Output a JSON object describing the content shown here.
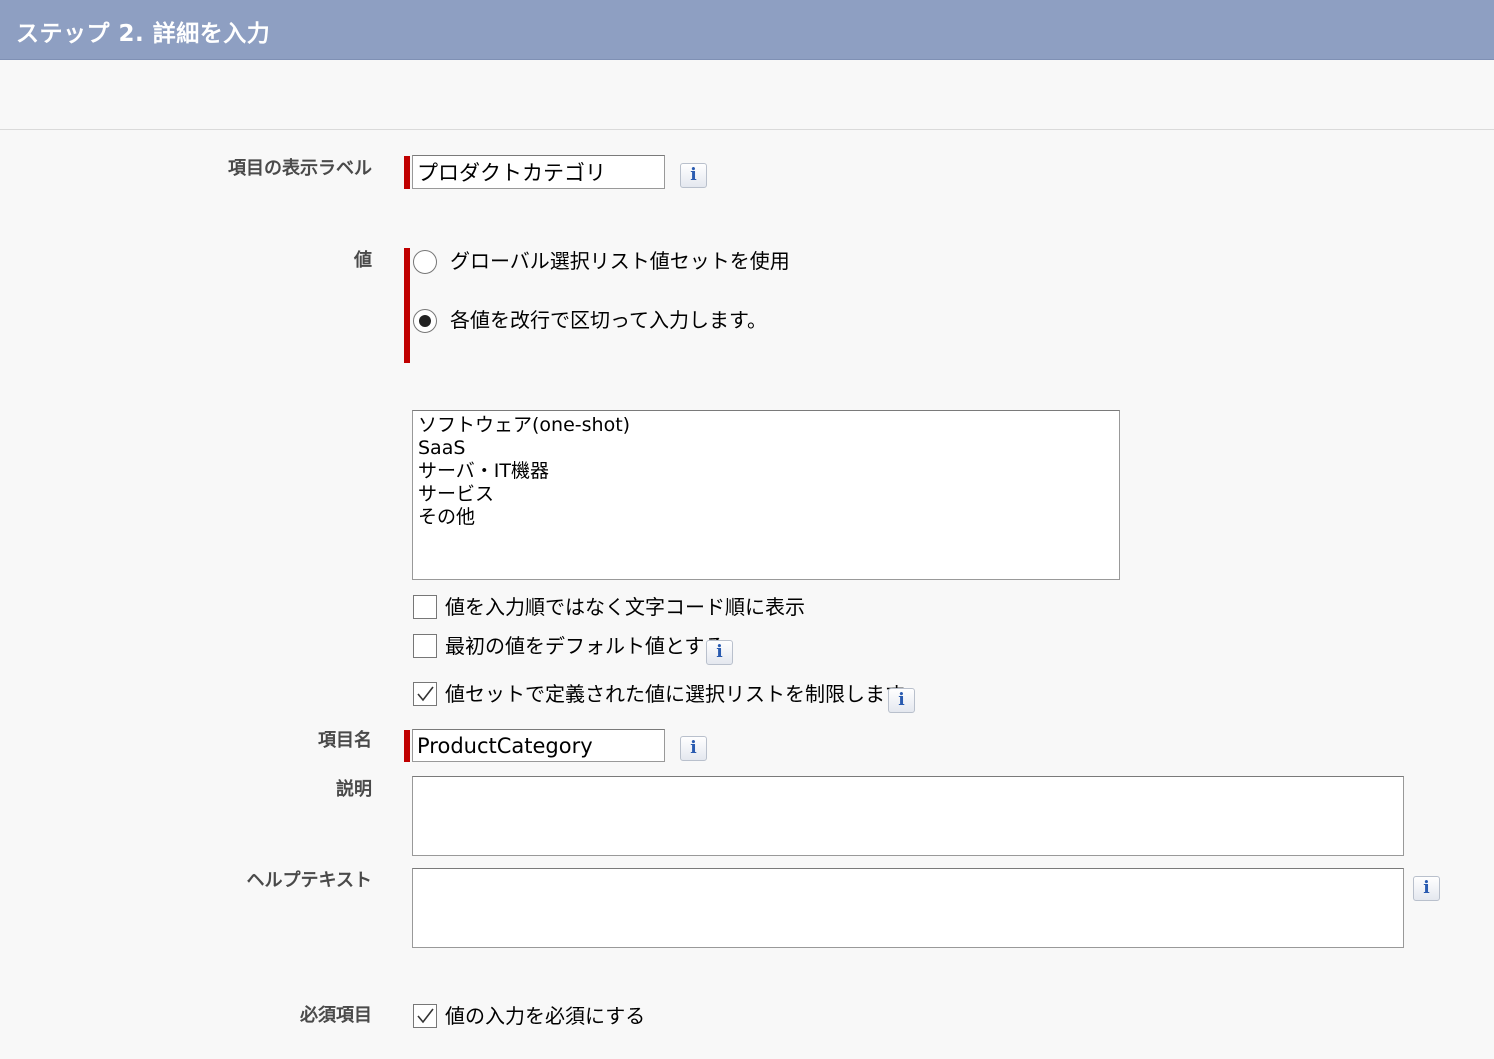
{
  "header": {
    "title": "ステップ 2. 詳細を入力"
  },
  "form": {
    "field_label": {
      "label": "項目の表示ラベル",
      "value": "プロダクトカテゴリ",
      "info_glyph": "i"
    },
    "values": {
      "label": "値",
      "options": [
        {
          "label": "グローバル選択リスト値セットを使用",
          "selected": false
        },
        {
          "label": "各値を改行で区切って入力します。",
          "selected": true
        }
      ],
      "entries": "ソフトウェア(one-shot)\nSaaS\nサーバ・IT機器\nサービス\nその他",
      "checkboxes": [
        {
          "label": "値を入力順ではなく文字コード順に表示",
          "checked": false
        },
        {
          "label": "最初の値をデフォルト値とする",
          "checked": false
        },
        {
          "label": "値セットで定義された値に選択リストを制限します",
          "checked": true
        }
      ]
    },
    "field_name": {
      "label": "項目名",
      "value": "ProductCategory"
    },
    "description": {
      "label": "説明",
      "value": ""
    },
    "help_text": {
      "label": "ヘルプテキスト",
      "value": ""
    },
    "required": {
      "label": "必須項目",
      "checkbox_label": "値の入力を必須にする",
      "checked": true
    }
  },
  "icons": {
    "info": "info-icon",
    "checkmark": "checkmark-icon"
  },
  "colors": {
    "header_bg": "#8e9fc2",
    "required_bar": "#c00000",
    "info_glyph": "#2a5bb0",
    "page_bg": "#f8f8f8"
  }
}
